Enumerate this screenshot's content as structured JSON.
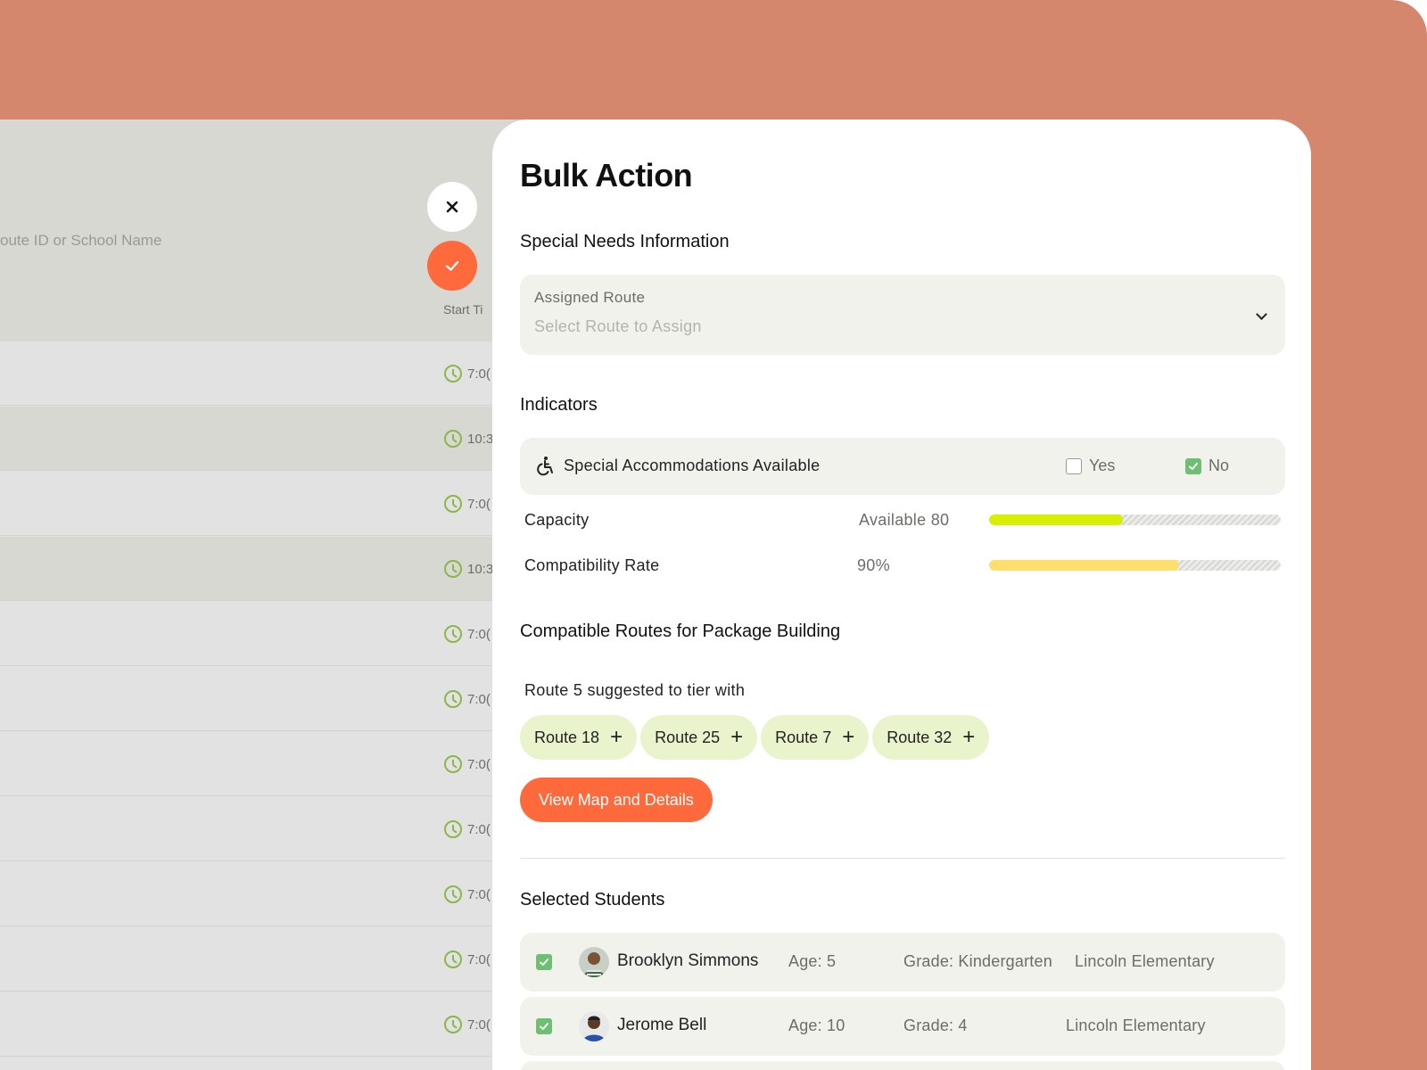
{
  "background_app": {
    "search_placeholder": "oute ID or School Name",
    "column_header": "Start Ti",
    "times": [
      "7:0(",
      "10:3",
      "7:0(",
      "10:3",
      "7:0(",
      "7:0(",
      "7:0(",
      "7:0(",
      "7:0(",
      "7:0(",
      "7:0("
    ]
  },
  "panel": {
    "title": "Bulk Action",
    "special_needs": {
      "heading": "Special Needs Information",
      "assigned_route_label": "Assigned Route",
      "assigned_route_placeholder": "Select Route to Assign"
    },
    "indicators": {
      "heading": "Indicators",
      "accommodation_label": "Special Accommodations Available",
      "yes_label": "Yes",
      "no_label": "No",
      "yes_checked": false,
      "no_checked": true,
      "capacity_label": "Capacity",
      "capacity_value": "Available 80",
      "capacity_fill": 0.46,
      "capacity_color": "#d6f000",
      "compat_label": "Compatibility Rate",
      "compat_value": "90%",
      "compat_fill": 0.65,
      "compat_color": "#ffdf6b"
    },
    "compatible": {
      "heading": "Compatible Routes for Package Building",
      "suggestion": "Route 5 suggested to tier with",
      "routes": [
        "Route 18",
        "Route 25",
        "Route 7",
        "Route 32"
      ],
      "view_button": "View Map and Details"
    },
    "students": {
      "heading": "Selected Students",
      "rows": [
        {
          "name": "Brooklyn Simmons",
          "age": "Age: 5",
          "grade": "Grade: Kindergarten",
          "school": "Lincoln Elementary",
          "checked": true
        },
        {
          "name": "Jerome Bell",
          "age": "Age: 10",
          "grade": "Grade: 4",
          "school": "Lincoln Elementary",
          "checked": true
        }
      ]
    }
  },
  "colors": {
    "accent": "#ff6a3d",
    "backdrop": "#d5876e",
    "check_green": "#6fbf73",
    "chip_bg": "#eaf4cc"
  }
}
